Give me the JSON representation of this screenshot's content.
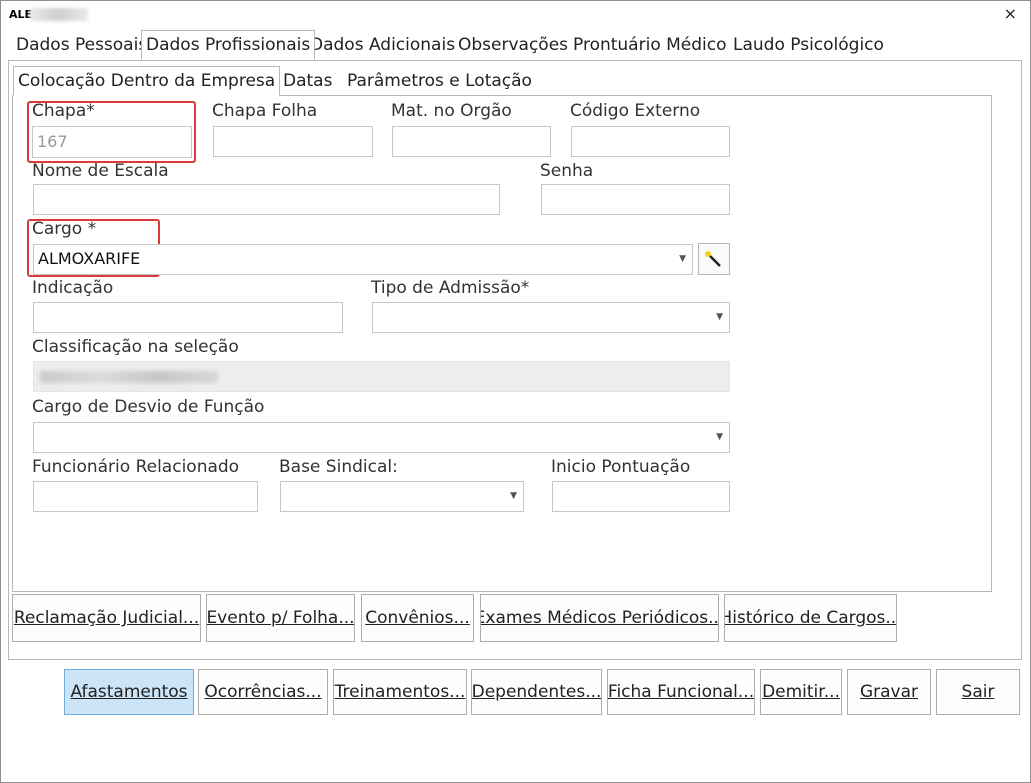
{
  "window": {
    "title": "ALE",
    "close_glyph": "×"
  },
  "main_tabs": [
    {
      "label": "Dados Pessoais"
    },
    {
      "label": "Dados Profissionais"
    },
    {
      "label": "Dados Adicionais"
    },
    {
      "label": "Observações"
    },
    {
      "label": "Prontuário Médico"
    },
    {
      "label": "Laudo Psicológico"
    }
  ],
  "sub_tabs": [
    {
      "label": "Colocação Dentro da Empresa"
    },
    {
      "label": "Datas"
    },
    {
      "label": "Parâmetros e Lotação"
    }
  ],
  "form": {
    "chapa": {
      "label": "Chapa*",
      "value": "167"
    },
    "chapa_folha": {
      "label": "Chapa Folha",
      "value": ""
    },
    "mat_orgao": {
      "label": "Mat. no Orgão",
      "value": ""
    },
    "codigo_externo": {
      "label": "Código Externo",
      "value": ""
    },
    "nome_escala": {
      "label": "Nome de Escala",
      "value": ""
    },
    "senha": {
      "label": "Senha",
      "value": ""
    },
    "cargo": {
      "label": "Cargo *",
      "value": "ALMOXARIFE"
    },
    "indicacao": {
      "label": "Indicação",
      "value": ""
    },
    "tipo_admissao": {
      "label": "Tipo de Admissão*",
      "value": ""
    },
    "classificacao": {
      "label": "Classificação na seleção"
    },
    "cargo_desvio": {
      "label": "Cargo de Desvio de Função",
      "value": ""
    },
    "funcionario_relacionado": {
      "label": "Funcionário Relacionado",
      "value": ""
    },
    "base_sindical": {
      "label": "Base Sindical:",
      "value": ""
    },
    "inicio_pontuacao": {
      "label": "Inicio Pontuação",
      "value": ""
    }
  },
  "panel_buttons": [
    {
      "label": "Reclamação Judicial..."
    },
    {
      "label": "Evento p/ Folha..."
    },
    {
      "label": "Convênios..."
    },
    {
      "label": "Exames Médicos Periódicos..."
    },
    {
      "label": "Histórico de Cargos..."
    }
  ],
  "footer_buttons": [
    {
      "label": "Afastamentos"
    },
    {
      "label": "Ocorrências..."
    },
    {
      "label": "Treinamentos..."
    },
    {
      "label": "Dependentes..."
    },
    {
      "label": "Ficha Funcional..."
    },
    {
      "label": "Demitir..."
    },
    {
      "label": "Gravar"
    },
    {
      "label": "Sair"
    }
  ],
  "icons": {
    "dropdown": "chevron-down-icon",
    "wand": "magic-wand-icon"
  },
  "colors": {
    "highlight": "#d93a3a",
    "primary_button": "#cce4f7"
  }
}
